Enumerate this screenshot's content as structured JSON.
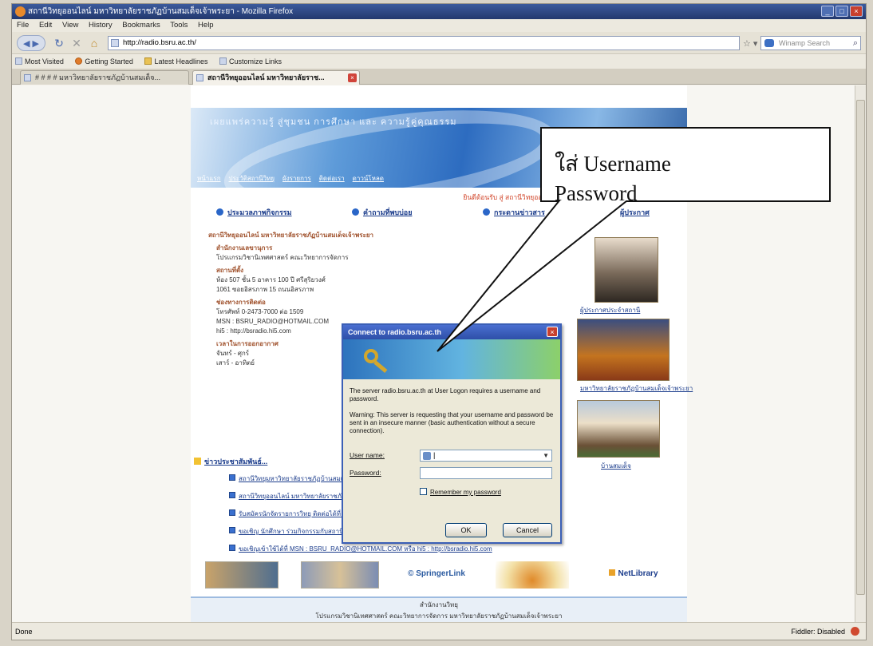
{
  "window": {
    "title": "สถานีวิทยุออนไลน์ มหาวิทยาลัยราชภัฏบ้านสมเด็จเจ้าพระยา - Mozilla Firefox",
    "buttons": [
      "_",
      "□",
      "×"
    ]
  },
  "menu": [
    "File",
    "Edit",
    "View",
    "History",
    "Bookmarks",
    "Tools",
    "Help"
  ],
  "toolbar": {
    "url": "http://radio.bsru.ac.th/",
    "search_placeholder": "Winamp Search",
    "star": "☆ ▾"
  },
  "bookmarks": [
    "Most Visited",
    "Getting Started",
    "Latest Headlines",
    "Customize Links"
  ],
  "tabs": [
    {
      "label": "# # # # มหาวิทยาลัยราชภัฏบ้านสมเด็จ..."
    },
    {
      "label": "สถานีวิทยุออนไลน์ มหาวิทยาลัยราช...",
      "close": "×"
    }
  ],
  "page": {
    "banner_title": "เผยแพร่ความรู้ สู่ชุมชน การศึกษา และ ความรู้คู่คุณธรรม",
    "banner_nav": [
      "หน้าแรก",
      "ประวัติสถานีวิทยุ",
      "ผังรายการ",
      "ติดต่อเรา",
      "ดาวน์โหลด"
    ],
    "marquee": "ยินดีต้อนรับ สู่ สถานีวิทยุออนไลน์ มหาวิทยาลัยราชภัฏบ้านสมเด็จเจ้าพระยา",
    "sections": [
      {
        "label": "ประมวลภาพกิจกรรม"
      },
      {
        "label": "คำถามที่พบบ่อย"
      },
      {
        "label": "กระดานข่าวสาร"
      },
      {
        "label": "ผู้ประกาศ"
      }
    ],
    "contact": {
      "title": "สถานีวิทยุออนไลน์ มหาวิทยาลัยราชภัฏบ้านสมเด็จเจ้าพระยา",
      "org_head": "สำนักงานเลขานุการ",
      "org": "โปรแกรมวิชานิเทศศาสตร์ คณะวิทยาการจัดการ",
      "addr_head": "สถานที่ตั้ง",
      "addr1": "ห้อง 507 ชั้น 5 อาคาร 100 ปี ศรีสุริยวงศ์",
      "addr2": "1061 ซอยอิสรภาพ 15 ถนนอิสรภาพ",
      "phone_head": "ช่องทางการติดต่อ",
      "phone": "โทรศัพท์ 0-2473-7000 ต่อ 1509",
      "msn": "MSN : BSRU_RADIO@HOTMAIL.COM",
      "hi5": "hi5 : http://bsradio.hi5.com",
      "hours_head": "เวลาในการออกอากาศ",
      "hours1": "จันทร์ - ศุกร์",
      "hours2": "เสาร์ - อาทิตย์"
    },
    "captions": [
      "ผู้ประกาศประจำสถานี",
      "มหาวิทยาลัยราชภัฏบ้านสมเด็จเจ้าพระยา",
      "บ้านสมเด็จ"
    ],
    "news_head": "ข่าวประชาสัมพันธ์...",
    "news": [
      "สถานีวิทยุมหาวิทยาลัยราชภัฏบ้านสมเด็จเจ้าพระยา ร่วมกับ สถานีวิทยุชุมชน 101.25",
      "สถานีวิทยุออนไลน์ มหาวิทยาลัยราชภัฏบ้านสมเด็จเจ้าพระยา ร่วมงาน 12 สิงหาคม",
      "รับสมัครนักจัดรายการวิทยุ ติดต่อได้ที่ สถานีวิทยุออนไลน์ มหาวิทยาลัยราชภัฏบ้านสมเด็จ",
      "ขอเชิญ นักศึกษา ร่วมกิจกรรมกับสถานีวิทยุออนไลน์",
      "ขอเชิญเข้าใช้ได้ที่ MSN : BSRU_RADIO@HOTMAIL.COM หรือ hi5 : http://bsradio.hi5.com"
    ],
    "logos": [
      "",
      "",
      "SpringerLink",
      "",
      "NetLibrary"
    ],
    "footer1": "สำนักงานวิทยุ",
    "footer2": "โปรแกรมวิชานิเทศศาสตร์ คณะวิทยาการจัดการ มหาวิทยาลัยราชภัฏบ้านสมเด็จเจ้าพระยา"
  },
  "dialog": {
    "title": "Connect to radio.bsru.ac.th",
    "close": "×",
    "message": "The server radio.bsru.ac.th at User Logon requires a username and password.",
    "warning": "Warning: This server is requesting that your username and password be sent in an insecure manner (basic authentication without a secure connection).",
    "user_label": "User name:",
    "pass_label": "Password:",
    "user_value": "|",
    "remember_label": "Remember my password",
    "ok": "OK",
    "cancel": "Cancel"
  },
  "callout": {
    "line1": "ใส่ Username",
    "line2": "Password"
  },
  "status": {
    "left": "Done",
    "right": "Fiddler: Disabled"
  }
}
